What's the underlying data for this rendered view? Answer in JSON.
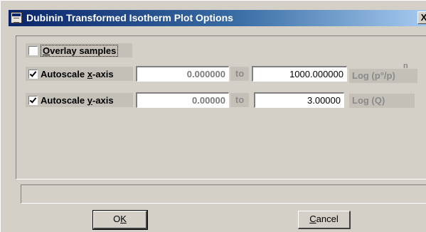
{
  "window": {
    "title": "Dubinin Transformed Isotherm Plot Options",
    "close_glyph": "X"
  },
  "overlay": {
    "label_mnemonic": "O",
    "label_rest": "verlay samples",
    "checked": false
  },
  "xaxis": {
    "label_pre": "Autoscale ",
    "label_mnemonic": "x",
    "label_post": "-axis",
    "checked": true,
    "from": "0.000000",
    "to_label": "to",
    "to": "1000.000000",
    "units": "Log (p°/p)",
    "units_sup": "n"
  },
  "yaxis": {
    "label_pre": "Autoscale ",
    "label_mnemonic": "y",
    "label_post": "-axis",
    "checked": true,
    "from": "0.00000",
    "to_label": "to",
    "to": "3.00000",
    "units": "Log (Q)"
  },
  "status": {
    "text": ""
  },
  "buttons": {
    "ok_pre": "O",
    "ok_mnemonic": "K",
    "ok_post": "",
    "cancel_pre": "",
    "cancel_mnemonic": "C",
    "cancel_post": "ancel"
  }
}
